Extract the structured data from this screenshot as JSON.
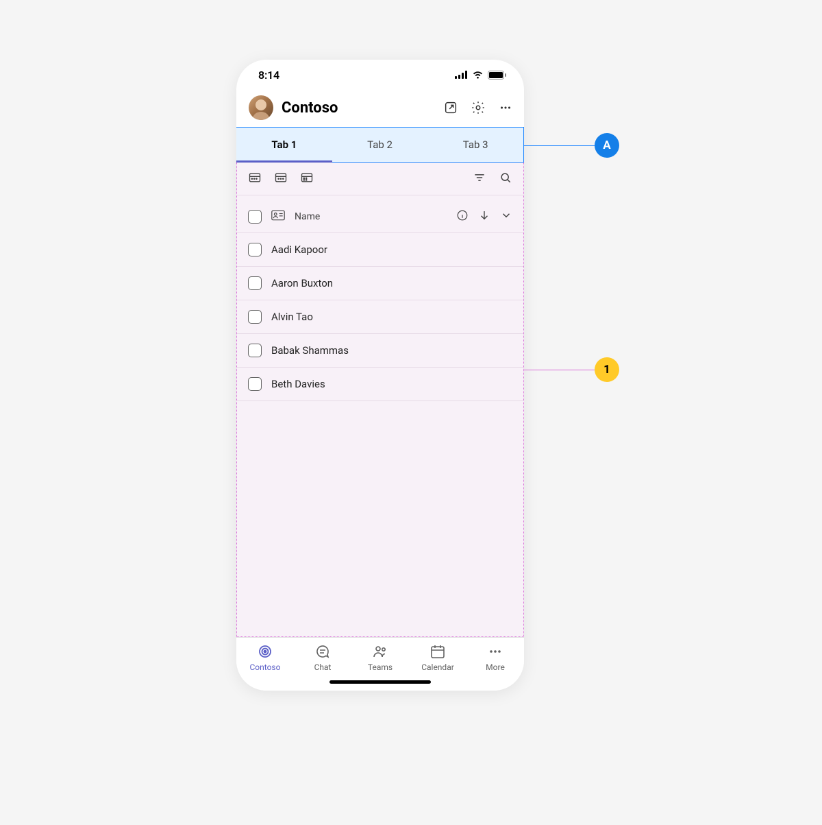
{
  "statusbar": {
    "time": "8:14"
  },
  "header": {
    "title": "Contoso"
  },
  "tabs": [
    {
      "label": "Tab 1",
      "active": true
    },
    {
      "label": "Tab 2",
      "active": false
    },
    {
      "label": "Tab 3",
      "active": false
    }
  ],
  "list": {
    "column_label": "Name",
    "rows": [
      {
        "name": "Aadi Kapoor"
      },
      {
        "name": "Aaron Buxton"
      },
      {
        "name": "Alvin Tao"
      },
      {
        "name": "Babak Shammas"
      },
      {
        "name": "Beth Davies"
      }
    ]
  },
  "bottomnav": [
    {
      "label": "Contoso",
      "active": true
    },
    {
      "label": "Chat",
      "active": false
    },
    {
      "label": "Teams",
      "active": false
    },
    {
      "label": "Calendar",
      "active": false
    },
    {
      "label": "More",
      "active": false
    }
  ],
  "annotations": {
    "A": "A",
    "1": "1"
  }
}
